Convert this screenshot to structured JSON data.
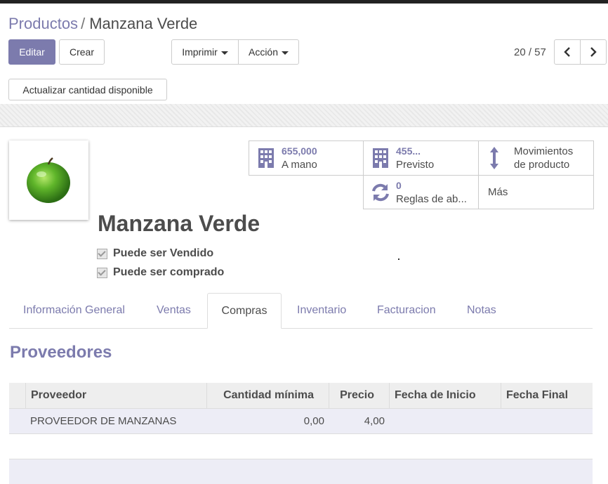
{
  "breadcrumb": {
    "parent": "Productos",
    "separator": "/",
    "current": "Manzana Verde"
  },
  "buttons": {
    "edit": "Editar",
    "create": "Crear",
    "print": "Imprimir",
    "action": "Acción",
    "update_qty": "Actualizar cantidad disponible"
  },
  "pager": {
    "value": "20 / 57"
  },
  "stats": {
    "onhand": {
      "value": "655,000",
      "label": "A mano"
    },
    "forecast": {
      "value": "455...",
      "label": "Previsto"
    },
    "moves": {
      "line1": "Movimientos",
      "line2": "de producto"
    },
    "rules": {
      "value": "0",
      "label": "Reglas de ab..."
    },
    "more": {
      "label": "Más"
    }
  },
  "product": {
    "name": "Manzana Verde",
    "can_be_sold": "Puede ser Vendido",
    "can_be_purchased": "Puede ser comprado"
  },
  "tabs": [
    "Información General",
    "Ventas",
    "Compras",
    "Inventario",
    "Facturacion",
    "Notas"
  ],
  "active_tab": "Compras",
  "section_title": "Proveedores",
  "suppliers_table": {
    "columns": [
      "Proveedor",
      "Cantidad mínima",
      "Precio",
      "Fecha de Inicio",
      "Fecha Final"
    ],
    "rows": [
      {
        "supplier": "PROVEEDOR DE MANZANAS",
        "min_qty": "0,00",
        "price": "4,00",
        "start": "",
        "end": ""
      }
    ]
  },
  "colors": {
    "accent": "#7c7bad",
    "text": "#4c4c4c"
  }
}
